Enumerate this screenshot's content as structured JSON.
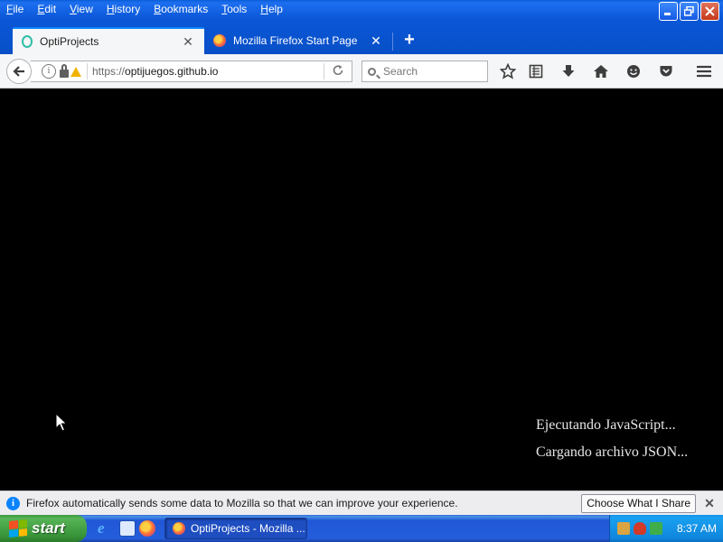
{
  "menu": [
    "File",
    "Edit",
    "View",
    "History",
    "Bookmarks",
    "Tools",
    "Help"
  ],
  "tabs": [
    {
      "label": "OptiProjects",
      "icon": "optiprojects-favicon",
      "active": true
    },
    {
      "label": "Mozilla Firefox Start Page",
      "icon": "firefox-icon",
      "active": false
    }
  ],
  "new_tab_label": "+",
  "url": {
    "prefix": "https://",
    "host": "optijuegos.github.io"
  },
  "search": {
    "placeholder": "Search"
  },
  "content": {
    "status_lines": [
      "Ejecutando JavaScript...",
      "Cargando archivo JSON..."
    ]
  },
  "notification": {
    "text": "Firefox automatically sends some data to Mozilla so that we can improve your experience.",
    "button": "Choose What I Share"
  },
  "taskbar": {
    "start_label": "start",
    "task_label": "OptiProjects - Mozilla ...",
    "time": "8:37 AM"
  }
}
